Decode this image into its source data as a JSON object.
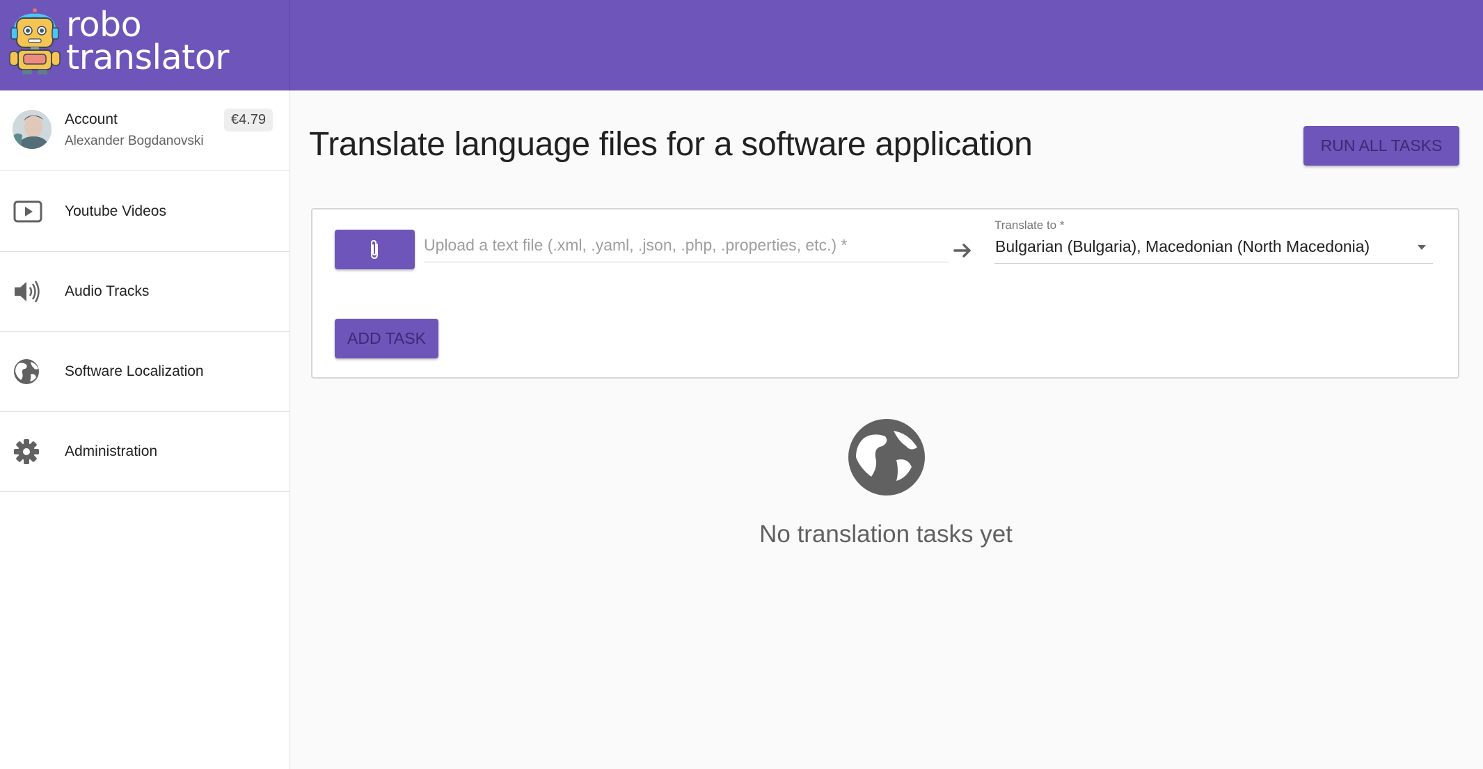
{
  "logo": {
    "line1": "robo",
    "line2": "translator"
  },
  "account": {
    "label": "Account",
    "name": "Alexander Bogdanovski",
    "balance": "€4.79"
  },
  "sidebar": {
    "items": [
      {
        "label": "Youtube Videos",
        "icon": "play-icon"
      },
      {
        "label": "Audio Tracks",
        "icon": "speaker-icon"
      },
      {
        "label": "Software Localization",
        "icon": "globe-icon"
      },
      {
        "label": "Administration",
        "icon": "gear-icon"
      }
    ]
  },
  "main": {
    "title": "Translate language files for a software application",
    "run_all_label": "RUN ALL TASKS",
    "upload_placeholder": "Upload a text file (.xml, .yaml, .json, .php, .properties, etc.) *",
    "translate_to_label": "Translate to *",
    "translate_to_value": "Bulgarian (Bulgaria), Macedonian (North Macedonia)",
    "add_task_label": "ADD TASK",
    "empty_text": "No translation tasks yet"
  },
  "colors": {
    "primary": "#6e55ba",
    "button_text": "#3b2a74",
    "background": "#fafafa"
  }
}
